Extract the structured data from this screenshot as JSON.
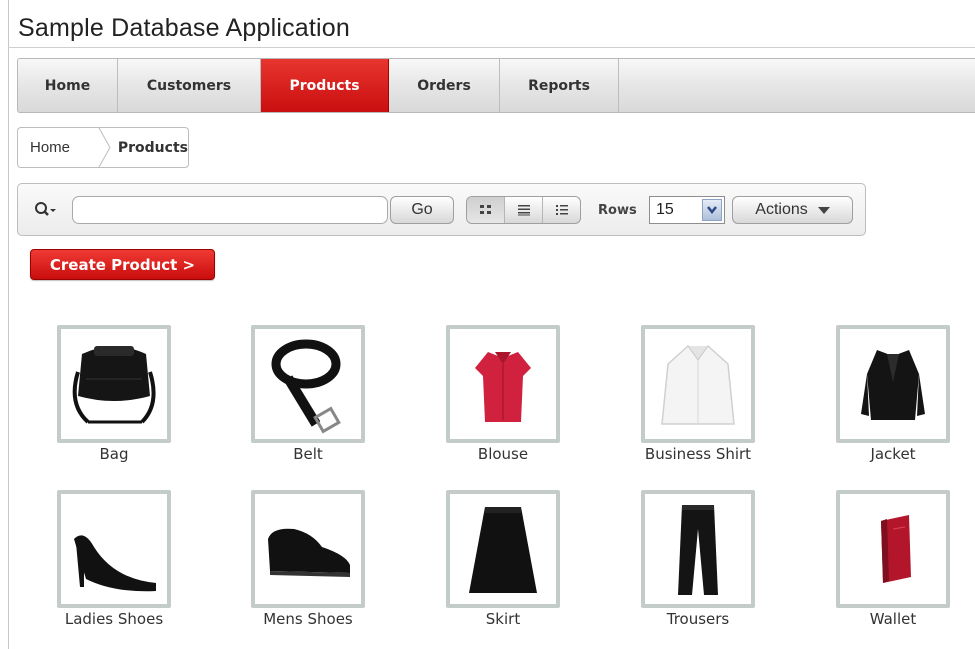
{
  "app": {
    "title": "Sample Database Application"
  },
  "tabs": [
    {
      "label": "Home",
      "active": false
    },
    {
      "label": "Customers",
      "active": false
    },
    {
      "label": "Products",
      "active": true
    },
    {
      "label": "Orders",
      "active": false
    },
    {
      "label": "Reports",
      "active": false
    }
  ],
  "breadcrumb": {
    "home": "Home",
    "current": "Products"
  },
  "toolbar": {
    "search_value": "",
    "go_label": "Go",
    "view_modes": [
      "icon-view",
      "report-view",
      "detail-view"
    ],
    "selected_view": "icon-view",
    "rows_label": "Rows",
    "rows_value": "15",
    "actions_label": "Actions"
  },
  "create_button": {
    "label": "Create Product >"
  },
  "products": [
    {
      "name": "Bag",
      "icon": "bag-image"
    },
    {
      "name": "Belt",
      "icon": "belt-image"
    },
    {
      "name": "Blouse",
      "icon": "blouse-image"
    },
    {
      "name": "Business Shirt",
      "icon": "business-shirt-image"
    },
    {
      "name": "Jacket",
      "icon": "jacket-image"
    },
    {
      "name": "Ladies Shoes",
      "icon": "ladies-shoes-image"
    },
    {
      "name": "Mens Shoes",
      "icon": "mens-shoes-image"
    },
    {
      "name": "Skirt",
      "icon": "skirt-image"
    },
    {
      "name": "Trousers",
      "icon": "trousers-image"
    },
    {
      "name": "Wallet",
      "icon": "wallet-image"
    }
  ],
  "colors": {
    "accent": "#d71a1a",
    "tab_active_text": "#ffffff",
    "thumb_border": "#c4ccca"
  }
}
